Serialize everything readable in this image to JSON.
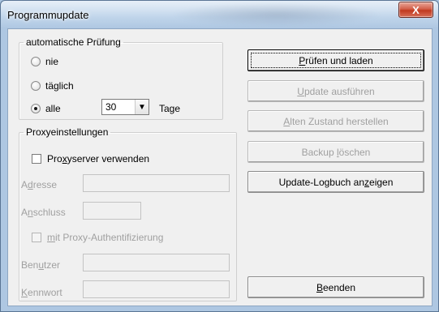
{
  "window": {
    "title": "Programmupdate",
    "close_glyph": "X"
  },
  "auto_check": {
    "legend": "automatische Prüfung",
    "options": [
      {
        "label": "nie",
        "checked": false
      },
      {
        "label": "täglich",
        "checked": false
      },
      {
        "label": "alle",
        "checked": true
      }
    ],
    "days_value": "30",
    "days_unit": "Tage"
  },
  "proxy": {
    "legend": "Proxyeinstellungen",
    "use_proxy_label_pre": "Pro",
    "use_proxy_label_accel": "x",
    "use_proxy_label_post": "yserver verwenden",
    "use_proxy_checked": false,
    "address_label_pre": "A",
    "address_label_accel": "d",
    "address_label_post": "resse",
    "address_value": "",
    "port_label_pre": "A",
    "port_label_accel": "n",
    "port_label_post": "schluss",
    "port_value": "",
    "auth_label_accel": "m",
    "auth_label_post": "it Proxy-Authentifizierung",
    "auth_checked": false,
    "user_label_pre": "Ben",
    "user_label_accel": "u",
    "user_label_post": "tzer",
    "user_value": "",
    "password_label_accel": "K",
    "password_label_post": "ennwort",
    "password_value": ""
  },
  "buttons": {
    "check_and_load": {
      "accel": "P",
      "rest": "rüfen und laden"
    },
    "run_update": {
      "accel": "U",
      "rest": "pdate ausführen"
    },
    "restore": {
      "accel": "A",
      "rest": "lten Zustand herstellen"
    },
    "backup_delete_pre": "Backup ",
    "backup_delete_accel": "l",
    "backup_delete_post": "öschen",
    "show_log_pre": "Update-Logbuch an",
    "show_log_accel": "z",
    "show_log_post": "eigen",
    "quit": {
      "accel": "B",
      "rest": "eenden"
    }
  },
  "icons": {
    "close": "close-icon",
    "dropdown": "chevron-down-icon"
  },
  "colors": {
    "window_frame": "#aec7e2",
    "close_button": "#c0391f",
    "disabled_text": "#a0a0a0"
  }
}
